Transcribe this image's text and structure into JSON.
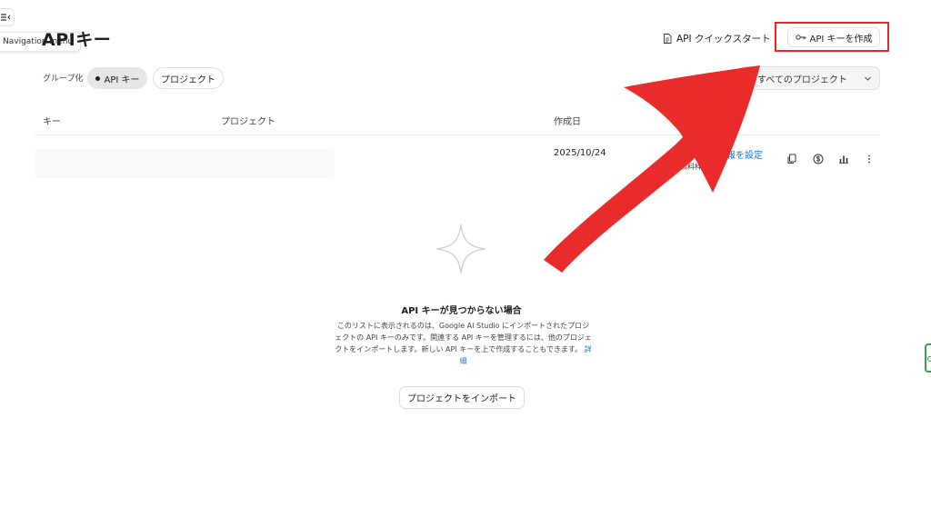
{
  "nav": {
    "tooltip": "Navigation menu"
  },
  "header": {
    "title": "APIキー",
    "quickstart_label": "API クイックスタート",
    "create_key_label": "API キーを作成"
  },
  "filters": {
    "group_label": "グループ化",
    "chips": [
      {
        "label": "API キー",
        "selected": true
      },
      {
        "label": "プロジェクト",
        "selected": false
      }
    ],
    "project_select_value": "すべてのプロジェクト"
  },
  "table": {
    "columns": [
      "キー",
      "プロジェクト",
      "作成日"
    ],
    "rows": [
      {
        "created": "2025/10/24",
        "billing_label": "お支払い情報を設定",
        "billing_sub": "無料枠",
        "actions": [
          "copy-icon",
          "billing-icon",
          "usage-chart-icon",
          "more-vert-icon"
        ]
      }
    ]
  },
  "empty_state": {
    "title": "API キーが見つからない場合",
    "description": "このリストに表示されるのは、Google AI Studio にインポートされたプロジェクトの API キーのみです。関連する API キーを管理するには、他のプロジェクトをインポートします。新しい API キーを上で作成することもできます。",
    "link_label": "詳細",
    "import_button_label": "プロジェクトをインポート"
  },
  "annotation": {
    "highlight_color": "#e32a2a",
    "arrow_color": "#ea2b2b"
  }
}
